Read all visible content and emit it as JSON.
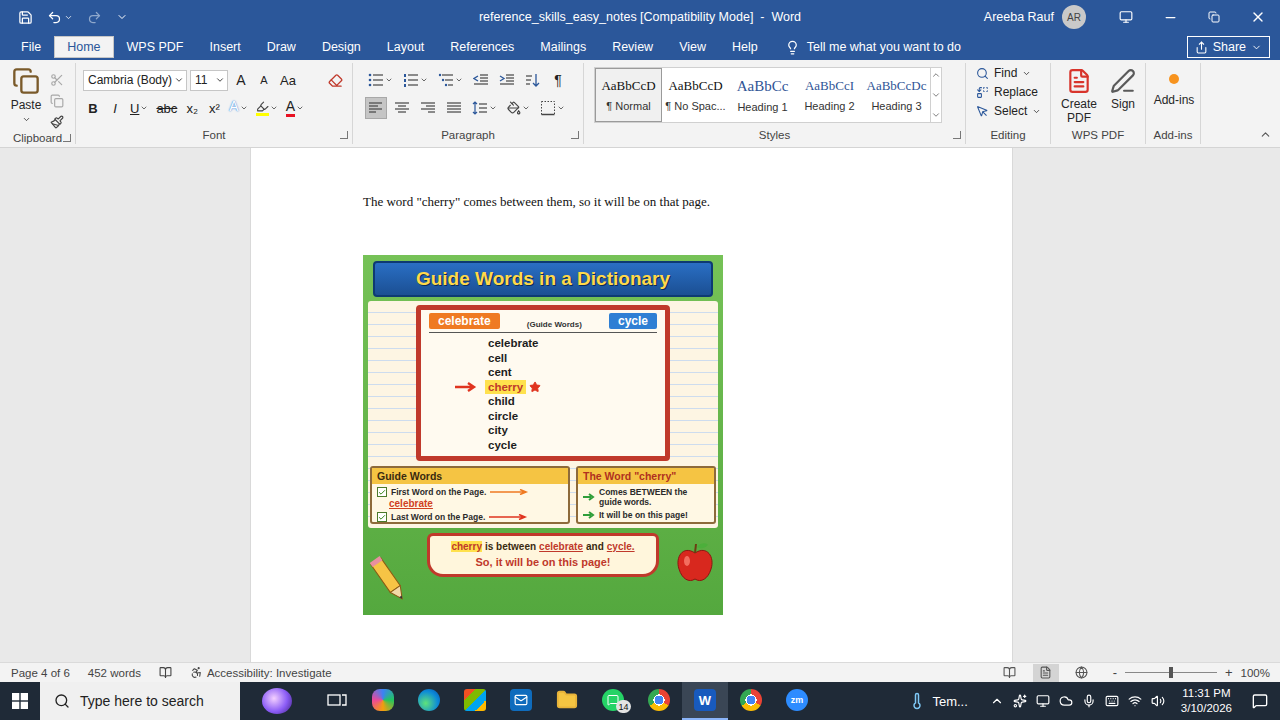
{
  "window": {
    "title": "reference_skills_easy_notes [Compatibility Mode]  -  Word",
    "user": "Areeba Rauf",
    "avatar": "AR"
  },
  "quick_access": [
    {
      "kind": "save",
      "disabled": false
    },
    {
      "kind": "undo",
      "disabled": false
    },
    {
      "kind": "redo",
      "disabled": true
    },
    {
      "kind": "customize",
      "disabled": false
    }
  ],
  "tabs": [
    {
      "label": "File",
      "selected": false
    },
    {
      "label": "Home",
      "selected": true
    },
    {
      "label": "WPS PDF",
      "selected": false
    },
    {
      "label": "Insert",
      "selected": false
    },
    {
      "label": "Draw",
      "selected": false
    },
    {
      "label": "Design",
      "selected": false
    },
    {
      "label": "Layout",
      "selected": false
    },
    {
      "label": "References",
      "selected": false
    },
    {
      "label": "Mailings",
      "selected": false
    },
    {
      "label": "Review",
      "selected": false
    },
    {
      "label": "View",
      "selected": false
    },
    {
      "label": "Help",
      "selected": false
    }
  ],
  "tell_me": "Tell me what you want to do",
  "share": "Share",
  "ribbon": {
    "clipboard": {
      "label": "Clipboard",
      "paste": "Paste",
      "tools": [
        {
          "kind": "cut",
          "disabled": true
        },
        {
          "kind": "copy",
          "disabled": true
        },
        {
          "kind": "format-painter",
          "disabled": false
        }
      ]
    },
    "font": {
      "label": "Font",
      "name": "Cambria (Body)",
      "size": "11",
      "size_buttons": [
        "A",
        "A",
        "Aa"
      ],
      "format_buttons": [
        {
          "text": "B",
          "kind": "bold"
        },
        {
          "text": "I",
          "kind": "italic"
        },
        {
          "text": "U",
          "kind": "underline"
        },
        {
          "text": "abc",
          "kind": "strike"
        },
        {
          "text": "x₂",
          "kind": "plain"
        },
        {
          "text": "x²",
          "kind": "plain"
        }
      ],
      "effects": "A",
      "font_color": "A"
    },
    "paragraph": {
      "label": "Paragraph",
      "show_marks": "¶",
      "align": [
        {
          "kind": "left",
          "selected": true
        },
        {
          "kind": "center",
          "selected": false
        },
        {
          "kind": "right",
          "selected": false
        },
        {
          "kind": "justify",
          "selected": false
        }
      ]
    },
    "styles": {
      "label": "Styles",
      "items": [
        {
          "sample": "AaBbCcD",
          "name": "¶ Normal",
          "kind": "normal",
          "selected": true
        },
        {
          "sample": "AaBbCcD",
          "name": "¶ No Spac...",
          "kind": "normal",
          "selected": false
        },
        {
          "sample": "AaBbCc",
          "name": "Heading 1",
          "kind": "heading1",
          "selected": false
        },
        {
          "sample": "AaBbCcI",
          "name": "Heading 2",
          "kind": "heading2",
          "selected": false
        },
        {
          "sample": "AaBbCcDc",
          "name": "Heading 3",
          "kind": "heading3",
          "selected": false
        }
      ]
    },
    "editing": {
      "label": "Editing",
      "items": [
        {
          "label": "Find",
          "kind": "menu"
        },
        {
          "label": "Replace",
          "kind": "button"
        },
        {
          "label": "Select",
          "kind": "menu"
        }
      ]
    },
    "wps": {
      "label": "WPS PDF",
      "items": [
        "Create PDF",
        "Sign"
      ]
    },
    "addins": {
      "label": "Add-ins",
      "items": [
        "Add-ins"
      ]
    }
  },
  "document": {
    "paragraph": "The word \"cherry\" comes between them, so it will be on that page.",
    "figure": {
      "title": "Guide Words in a Dictionary",
      "first_guide": "celebrate",
      "last_guide": "cycle",
      "guide_caption": "(Guide Words)",
      "words": [
        {
          "text": "celebrate",
          "selected": false
        },
        {
          "text": "cell",
          "selected": false
        },
        {
          "text": "cent",
          "selected": false
        },
        {
          "text": "cherry",
          "selected": true
        },
        {
          "text": "child",
          "selected": false
        },
        {
          "text": "circle",
          "selected": false
        },
        {
          "text": "city",
          "selected": false
        },
        {
          "text": "cycle",
          "selected": false
        }
      ],
      "left_box": {
        "title": "Guide Words",
        "items": [
          {
            "text": "First Word on the Page.",
            "word": "celebrate"
          },
          {
            "text": "Last Word on the Page."
          }
        ]
      },
      "right_box": {
        "title": "The Word \"cherry\"",
        "items": [
          "Comes BETWEEN the guide words.",
          "It will be on this page!"
        ]
      },
      "summary": [
        {
          "text": "cherry",
          "kind": "highlight"
        },
        {
          "text": "is between",
          "kind": "plain"
        },
        {
          "text": "celebrate",
          "kind": "accent"
        },
        {
          "text": "and",
          "kind": "plain"
        },
        {
          "text": "cycle.",
          "kind": "accent"
        }
      ],
      "conclusion": "So, it will be on this page!"
    }
  },
  "status_bar": {
    "page": "Page 4 of 6",
    "words": "452 words",
    "accessibility": "Accessibility: Investigate",
    "zoom_out": "-",
    "zoom_in": "+",
    "zoom": "100%",
    "zoom_level": 0.5,
    "views": [
      {
        "kind": "read",
        "selected": false
      },
      {
        "kind": "print",
        "selected": true
      },
      {
        "kind": "web",
        "selected": false
      }
    ]
  },
  "taskbar": {
    "search": "Type here to search",
    "apps": [
      {
        "kind": "copilot",
        "selected": false
      },
      {
        "kind": "edge",
        "selected": false
      },
      {
        "kind": "store",
        "selected": false
      },
      {
        "kind": "outlook",
        "selected": false
      },
      {
        "kind": "explorer",
        "selected": false
      },
      {
        "kind": "whatsapp",
        "selected": false,
        "badge": "14"
      },
      {
        "kind": "chrome",
        "selected": false
      },
      {
        "kind": "word",
        "selected": true,
        "label": "W"
      },
      {
        "kind": "chrome",
        "selected": false
      },
      {
        "kind": "zoom",
        "selected": false,
        "label": "zm"
      }
    ],
    "weather": "Tem...",
    "time": "11:31 PM",
    "date": "3/10/2026"
  }
}
